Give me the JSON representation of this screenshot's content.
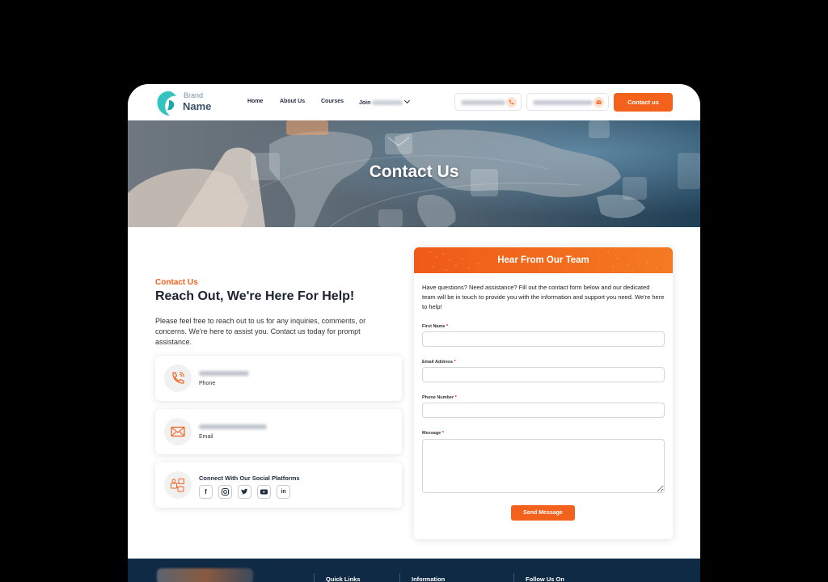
{
  "header": {
    "logo": {
      "top": "Brand",
      "bottom": "Name"
    },
    "nav": [
      "Home",
      "About Us",
      "Courses",
      "Join"
    ],
    "cta": "Contact us",
    "colors": {
      "accent": "#f2621c",
      "navy": "#0f2a45"
    }
  },
  "hero": {
    "title": "Contact Us"
  },
  "contact": {
    "kicker": "Contact Us",
    "headline": "Reach Out, We're Here For Help!",
    "intro": "Please feel free to reach out to us for any inquiries, comments, or concerns. We're here to assist you. Contact us today for prompt assistance.",
    "phone": {
      "label": "Phone",
      "icon": "phone-icon"
    },
    "email": {
      "label": "Email",
      "icon": "mail-icon"
    },
    "social": {
      "title": "Connect With Our Social Platforms",
      "icons": [
        "facebook-icon",
        "instagram-icon",
        "twitter-icon",
        "youtube-icon",
        "linkedin-icon"
      ]
    }
  },
  "form": {
    "title": "Hear From Our Team",
    "description": "Have questions? Need assistance? Fill out the contact form below and our dedicated team will be in touch to provide you with the information and support you need. We're here to help!",
    "fields": {
      "first_name": "First Name",
      "email": "Email Address",
      "phone": "Phone Number",
      "message": "Message"
    },
    "required_mark": "*",
    "submit": "Send Message"
  },
  "footer": {
    "headings": [
      "Quick Links",
      "Information",
      "Follow Us On"
    ]
  }
}
